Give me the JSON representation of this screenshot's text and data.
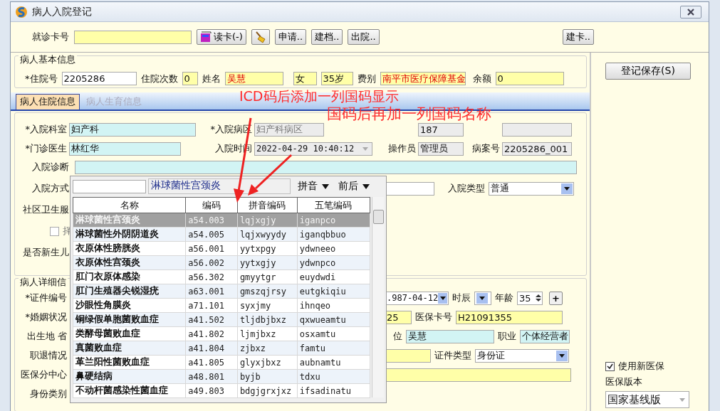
{
  "window": {
    "title": "病人入院登记"
  },
  "toolbar": {
    "card_label": "就诊卡号",
    "buttons": [
      {
        "kind": "read_card",
        "label": "读卡(-)"
      },
      {
        "kind": "clear"
      },
      {
        "kind": "text",
        "label": "申请.."
      },
      {
        "kind": "text",
        "label": "建档.."
      },
      {
        "kind": "text",
        "label": "出院.."
      },
      {
        "kind": "text",
        "label": "建卡.."
      }
    ]
  },
  "basic_info": {
    "title": "病人基本信息",
    "inpatient_no": {
      "label": "*住院号",
      "value": "2205286"
    },
    "admit_count": {
      "label": "住院次数",
      "value": "0"
    },
    "name": {
      "label": "姓名",
      "value": "吴慧"
    },
    "sex": {
      "value": "女"
    },
    "age": {
      "value": "35岁"
    },
    "fee_type": {
      "label": "费别",
      "value": "南平市医疗保障基金"
    },
    "balance": {
      "label": "余额",
      "value": "0"
    }
  },
  "tabs": [
    {
      "label": "病人住院信息",
      "selected": true
    },
    {
      "label": "病人生育信息",
      "selected": false
    }
  ],
  "admission": {
    "dept": {
      "label": "*入院科室",
      "value": "妇产科"
    },
    "ward": {
      "label": "*入院病区",
      "value": "妇产科病区"
    },
    "beds": {
      "value": "187"
    },
    "doctor": {
      "label": "*门诊医生",
      "value": "林红华"
    },
    "admit_time": {
      "label": "入院时间",
      "value": "2022-04-29 10:40:12"
    },
    "operator": {
      "label": "操作员",
      "value": "管理员"
    },
    "case_no": {
      "label": "病案号",
      "value": "2205286_001"
    },
    "diagnosis": {
      "label": "入院诊断"
    },
    "admit_mode": {
      "label": "入院方式"
    },
    "admit_type": {
      "label": "入院类型",
      "value": "普通"
    },
    "community": {
      "label": "社区卫生服"
    },
    "select_date": {
      "label": "择",
      "checked": false
    },
    "newborn": {
      "label": "是否新生儿"
    }
  },
  "details": {
    "title": "病人详细信",
    "labels": [
      "*证件编号",
      "*婚姻状况",
      "出生地 省",
      "职退情况",
      "医保分中心",
      "身份类别"
    ],
    "birth_date": {
      "value": ".987-04-12"
    },
    "birth_hour": {
      "label": "时辰"
    },
    "age": {
      "label": "年龄",
      "value": "35"
    },
    "plus": "+",
    "marriage_field": {
      "value": "25"
    },
    "insurance_card": {
      "label": "医保卡号",
      "value": "H21091355"
    },
    "employer": {
      "label": "位",
      "value": "吴慧"
    },
    "occupation": {
      "label": "职业",
      "value": "个体经营者"
    },
    "id_type": {
      "label": "证件类型",
      "value": "身份证"
    }
  },
  "side": {
    "save_button": "登记保存(S)",
    "new_insurance": {
      "label": "使用新医保",
      "checked": true
    },
    "version_label": "医保版本",
    "version": "国家基线版"
  },
  "popup": {
    "search_label": "淋球菌性宫颈炎",
    "options": [
      {
        "label": "拼音"
      },
      {
        "label": "前后"
      }
    ],
    "columns": [
      "名称",
      "编码",
      "拼音编码",
      "五笔编码"
    ],
    "rows": [
      {
        "cells": [
          "淋球菌性宫颈炎",
          "a54.003",
          "lqjxgjy",
          "iganpco"
        ],
        "selected": true
      },
      {
        "cells": [
          "淋球菌性外阴阴道炎",
          "a54.005",
          "lqjxwyydy",
          "iganqbbuo"
        ],
        "selected": false
      },
      {
        "cells": [
          "衣原体性膀胱炎",
          "a56.001",
          "yytxpgy",
          "ydwneeo"
        ],
        "selected": false
      },
      {
        "cells": [
          "衣原体性宫颈炎",
          "a56.002",
          "yytxgjy",
          "ydwnpco"
        ],
        "selected": false
      },
      {
        "cells": [
          "肛门衣原体感染",
          "a56.302",
          "gmyytgr",
          "euydwdi"
        ],
        "selected": false
      },
      {
        "cells": [
          "肛门生殖器尖锐湿疣",
          "a63.001",
          "gmszqjrsy",
          "eutgkiqiu"
        ],
        "selected": false
      },
      {
        "cells": [
          "沙眼性角膜炎",
          "a71.101",
          "syxjmy",
          "ihnqeo"
        ],
        "selected": false
      },
      {
        "cells": [
          "铜绿假单胞菌败血症",
          "a41.502",
          "tljdbjbxz",
          "qxwueamtu"
        ],
        "selected": false
      },
      {
        "cells": [
          "类酵母菌败血症",
          "a41.802",
          "ljmjbxz",
          "osxamtu"
        ],
        "selected": false
      },
      {
        "cells": [
          "真菌败血症",
          "a41.804",
          "zjbxz",
          "famtu"
        ],
        "selected": false
      },
      {
        "cells": [
          "革兰阳性菌败血症",
          "a41.805",
          "glyxjbxz",
          "aubnamtu"
        ],
        "selected": false
      },
      {
        "cells": [
          "鼻硬结病",
          "a48.801",
          "byjb",
          "tdxu"
        ],
        "selected": false
      },
      {
        "cells": [
          "不动杆菌感染性菌血症",
          "a49.803",
          "bdgjgrxjxz",
          "ifsadinatu"
        ],
        "selected": false
      }
    ]
  },
  "annotations": [
    {
      "text": "ICD码后添加一列国码显示"
    },
    {
      "text": "国码后再加一列国码名称"
    }
  ]
}
